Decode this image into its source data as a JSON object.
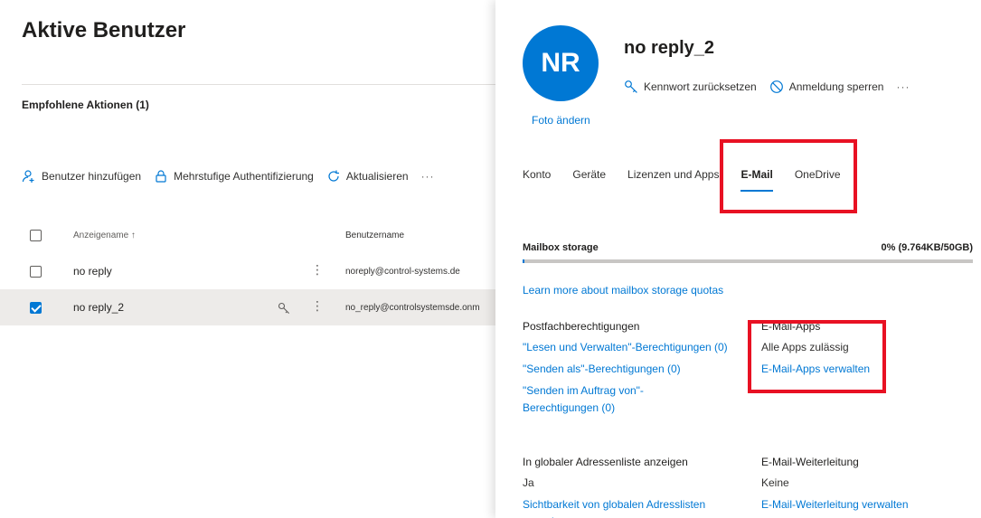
{
  "left": {
    "title": "Aktive Benutzer",
    "recommended": "Empfohlene Aktionen (1)",
    "toolbar": {
      "add_user": "Benutzer hinzufügen",
      "mfa": "Mehrstufige Authentifizierung",
      "refresh": "Aktualisieren",
      "more": "···"
    },
    "table": {
      "col_display": "Anzeigename ↑",
      "col_username": "Benutzername",
      "rows": [
        {
          "name": "no reply",
          "username": "noreply@control-systems.de",
          "selected": false
        },
        {
          "name": "no reply_2",
          "username": "no_reply@controlsystemsde.onm",
          "selected": true
        }
      ]
    }
  },
  "panel": {
    "initials": "NR",
    "change_photo": "Foto ändern",
    "user_name": "no reply_2",
    "actions": {
      "reset_password": "Kennwort zurücksetzen",
      "block_signin": "Anmeldung sperren",
      "more": "···"
    },
    "tabs": [
      "Konto",
      "Geräte",
      "Lizenzen und Apps",
      "E-Mail",
      "OneDrive"
    ],
    "active_tab": "E-Mail",
    "mailbox": {
      "label": "Mailbox storage",
      "value": "0% (9.764KB/50GB)",
      "percent": 0.02,
      "learn_more": "Learn more about mailbox storage quotas"
    },
    "permissions": {
      "heading": "Postfachberechtigungen",
      "read_manage": "\"Lesen und Verwalten\"-Berechtigungen (0)",
      "send_as": "\"Senden als\"-Berechtigungen (0)",
      "send_on_behalf": "\"Senden im Auftrag von\"-Berechtigungen (0)"
    },
    "email_apps": {
      "heading": "E-Mail-Apps",
      "value": "Alle Apps zulässig",
      "manage": "E-Mail-Apps verwalten"
    },
    "gal": {
      "heading": "In globaler Adressenliste anzeigen",
      "value": "Ja",
      "link": "Sichtbarkeit von globalen Adresslisten verwalten"
    },
    "forwarding": {
      "heading": "E-Mail-Weiterleitung",
      "value": "Keine",
      "link": "E-Mail-Weiterleitung verwalten"
    }
  },
  "colors": {
    "accent": "#0078d4",
    "highlight": "#e81123",
    "selected_row": "#edebe9"
  }
}
